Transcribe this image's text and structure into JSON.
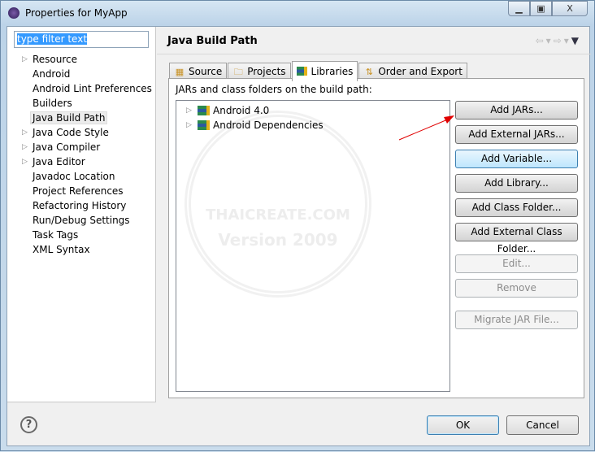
{
  "window": {
    "title": "Properties for MyApp",
    "controls": [
      "minimize",
      "maximize",
      "close"
    ]
  },
  "sidebar": {
    "filter_value": "type filter text",
    "items": [
      {
        "label": "Resource",
        "expandable": true
      },
      {
        "label": "Android",
        "expandable": false
      },
      {
        "label": "Android Lint Preferences",
        "expandable": false
      },
      {
        "label": "Builders",
        "expandable": false
      },
      {
        "label": "Java Build Path",
        "expandable": false,
        "selected": true
      },
      {
        "label": "Java Code Style",
        "expandable": true
      },
      {
        "label": "Java Compiler",
        "expandable": true
      },
      {
        "label": "Java Editor",
        "expandable": true
      },
      {
        "label": "Javadoc Location",
        "expandable": false
      },
      {
        "label": "Project References",
        "expandable": false
      },
      {
        "label": "Refactoring History",
        "expandable": false
      },
      {
        "label": "Run/Debug Settings",
        "expandable": false
      },
      {
        "label": "Task Tags",
        "expandable": false
      },
      {
        "label": "XML Syntax",
        "expandable": false
      }
    ]
  },
  "header": {
    "title": "Java Build Path"
  },
  "tabs": [
    {
      "label": "Source"
    },
    {
      "label": "Projects"
    },
    {
      "label": "Libraries",
      "active": true
    },
    {
      "label": "Order and Export"
    }
  ],
  "libraries": {
    "caption": "JARs and class folders on the build path:",
    "entries": [
      {
        "label": "Android 4.0"
      },
      {
        "label": "Android Dependencies"
      }
    ],
    "watermark": [
      "THAICREATE.COM",
      "Version 2009"
    ]
  },
  "buttons": [
    {
      "label": "Add JARs...",
      "enabled": true
    },
    {
      "label": "Add External JARs...",
      "enabled": true
    },
    {
      "label": "Add Variable...",
      "enabled": true,
      "hover": true
    },
    {
      "label": "Add Library...",
      "enabled": true
    },
    {
      "label": "Add Class Folder...",
      "enabled": true
    },
    {
      "label": "Add External Class Folder...",
      "enabled": true
    },
    {
      "label": "Edit...",
      "enabled": false
    },
    {
      "label": "Remove",
      "enabled": false
    },
    {
      "label": "Migrate JAR File...",
      "enabled": false
    }
  ],
  "footer": {
    "ok": "OK",
    "cancel": "Cancel",
    "help": "?"
  },
  "annotation_color": "#e00000"
}
